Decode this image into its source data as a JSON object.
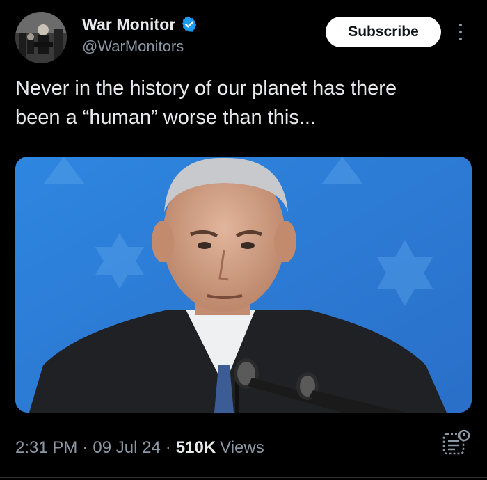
{
  "post": {
    "author": {
      "display_name": "War Monitor",
      "handle": "@WarMonitors",
      "verified": true,
      "avatar_icon": "profile-avatar"
    },
    "subscribe_label": "Subscribe",
    "more_icon": "more-vertical-icon",
    "text": "Never in the history of our planet has there\nbeen a “human” worse than this...",
    "media": {
      "type": "photo",
      "icon": "photo"
    },
    "meta": {
      "time": "2:31 PM",
      "separator": "·",
      "date": "09 Jul 24",
      "views_count": "510K",
      "views_label": "Views"
    },
    "analytics_icon": "analytics-icon"
  },
  "colors": {
    "background": "#000000",
    "text_primary": "#e7e9ea",
    "text_secondary": "#8b98a5",
    "verified_blue": "#1d9bf0",
    "subscribe_bg": "#ffffff",
    "media_blue": "#2f7fd6"
  }
}
